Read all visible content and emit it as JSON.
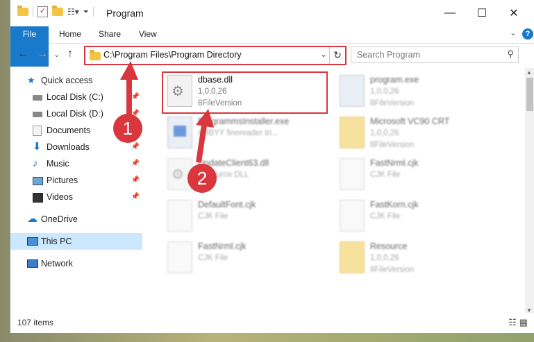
{
  "window": {
    "title": "Program",
    "minimize": "—",
    "maximize": "☐",
    "close": "✕"
  },
  "ribbon": {
    "tabs": [
      "File",
      "Home",
      "Share",
      "View"
    ],
    "help": "?"
  },
  "address": {
    "path": "C:\\Program Files\\Program Directory",
    "search_placeholder": "Search Program"
  },
  "sidebar": {
    "items": [
      {
        "label": "Quick access",
        "icon": "star-icon"
      },
      {
        "label": "Local Disk (C:)",
        "icon": "drive-icon"
      },
      {
        "label": "Local Disk (D:)",
        "icon": "drive-icon"
      },
      {
        "label": "Documents",
        "icon": "documents-icon"
      },
      {
        "label": "Downloads",
        "icon": "downloads-icon"
      },
      {
        "label": "Music",
        "icon": "music-icon"
      },
      {
        "label": "Pictures",
        "icon": "pictures-icon"
      },
      {
        "label": "Videos",
        "icon": "videos-icon"
      },
      {
        "label": "OneDrive",
        "icon": "cloud-icon"
      },
      {
        "label": "This PC",
        "icon": "computer-icon"
      },
      {
        "label": "Network",
        "icon": "network-icon"
      }
    ]
  },
  "files": [
    {
      "name": "dbase.dll",
      "line2": "1,0,0,26",
      "line3": "8FileVersion",
      "icon": "dll-icon"
    },
    {
      "name": "program.exe",
      "line2": "1,0,0,26",
      "line3": "8FileVersion",
      "icon": "exe-icon"
    },
    {
      "name": "ProgrammsInstaller.exe",
      "line2": "ABBYY finereader tri...",
      "line3": "",
      "icon": "exe-icon"
    },
    {
      "name": "Microsoft VC90 CRT",
      "line2": "1,0,0,26",
      "line3": "8FileVersion",
      "icon": "folder-icon"
    },
    {
      "name": "UpdateClient63.dll",
      "line2": "Resource DLL",
      "line3": "",
      "icon": "dll-icon"
    },
    {
      "name": "FastNrml.cjk",
      "line2": "CJK File",
      "line3": "",
      "icon": "file-icon"
    },
    {
      "name": "DefaultFont.cjk",
      "line2": "CJK File",
      "line3": "",
      "icon": "file-icon"
    },
    {
      "name": "FastKorn.cjk",
      "line2": "CJK File",
      "line3": "",
      "icon": "file-icon"
    },
    {
      "name": "FastNrml.cjk",
      "line2": "CJK File",
      "line3": "",
      "icon": "file-icon"
    },
    {
      "name": "Resource",
      "line2": "1,0,0,26",
      "line3": "8FileVersion",
      "icon": "folder-icon"
    }
  ],
  "status": {
    "count": "107 items"
  },
  "annotations": {
    "step1": "1",
    "step2": "2"
  },
  "colors": {
    "accent": "#1979ca",
    "highlight": "#d9363e"
  }
}
